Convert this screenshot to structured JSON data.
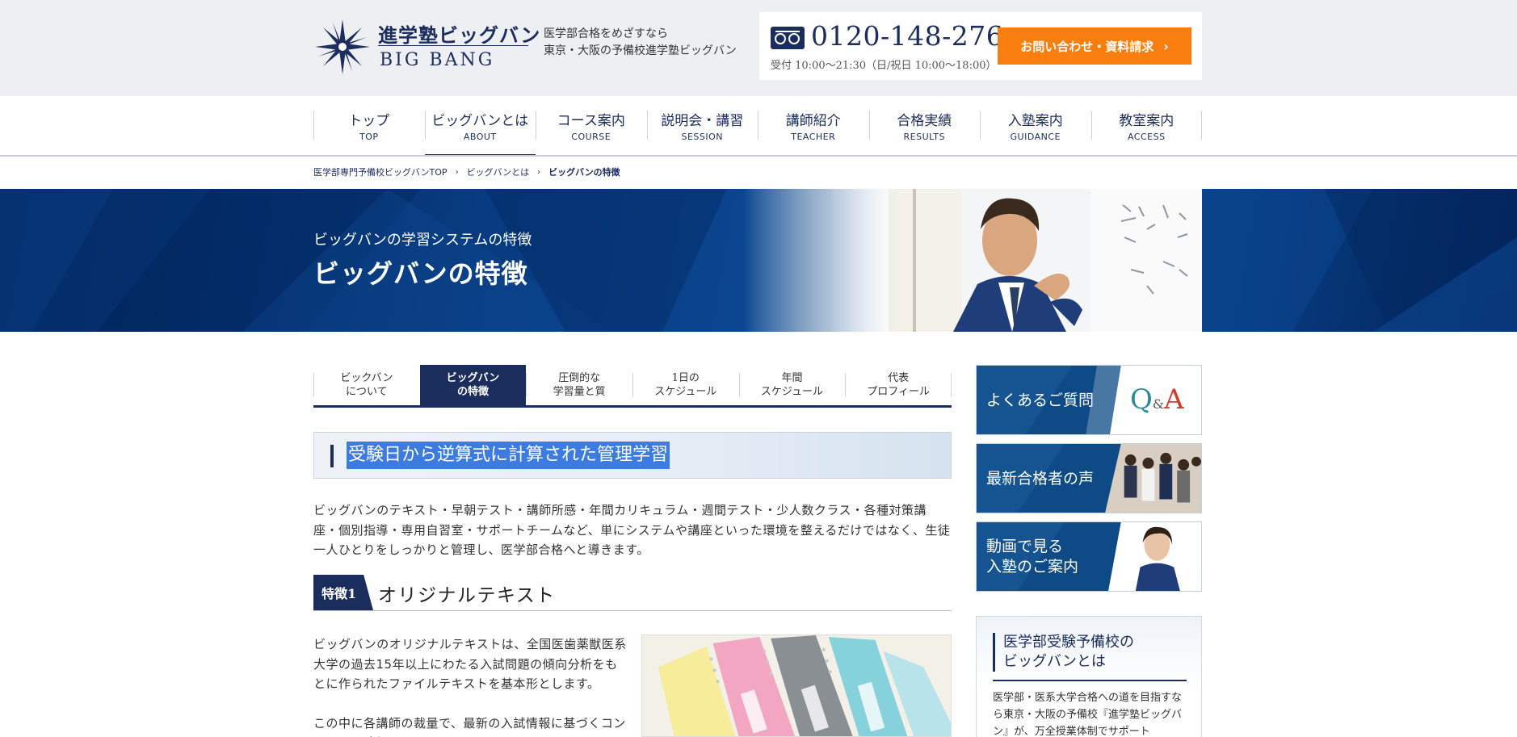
{
  "header": {
    "logo_jp": "進学塾ビッグバン",
    "logo_en": "BIG BANG",
    "tagline_line1": "医学部合格をめざすなら",
    "tagline_line2": "東京・大阪の予備校進学塾ビッグバン",
    "phone": "0120-148-276",
    "hours": "受付 10:00〜21:30（日/祝日 10:00〜18:00）",
    "cta_label": "お問い合わせ・資料請求",
    "cta_chevron": "›"
  },
  "nav": [
    {
      "jp": "トップ",
      "en": "TOP"
    },
    {
      "jp": "ビッグバンとは",
      "en": "ABOUT"
    },
    {
      "jp": "コース案内",
      "en": "COURSE"
    },
    {
      "jp": "説明会・講習",
      "en": "SESSION"
    },
    {
      "jp": "講師紹介",
      "en": "TEACHER"
    },
    {
      "jp": "合格実績",
      "en": "RESULTS"
    },
    {
      "jp": "入塾案内",
      "en": "GUIDANCE"
    },
    {
      "jp": "教室案内",
      "en": "ACCESS"
    }
  ],
  "nav_active_index": 1,
  "breadcrumb": {
    "home": "医学部専門予備校ビッグバンTOP",
    "parent": "ビッグバンとは",
    "current": "ビッグバンの特徴",
    "sep": "›"
  },
  "hero": {
    "subtitle": "ビッグバンの学習システムの特徴",
    "title": "ビッグバンの特徴"
  },
  "subtabs": [
    {
      "line1": "ビックバン",
      "line2": "について"
    },
    {
      "line1": "ビッグバン",
      "line2": "の特徴"
    },
    {
      "line1": "圧倒的な",
      "line2": "学習量と質"
    },
    {
      "line1": "1日の",
      "line2": "スケジュール"
    },
    {
      "line1": "年間",
      "line2": "スケジュール"
    },
    {
      "line1": "代表",
      "line2": "プロフィール"
    }
  ],
  "subtab_active_index": 1,
  "main": {
    "section_heading": "受験日から逆算式に計算された管理学習",
    "intro": "ビッグバンのテキスト・早朝テスト・講師所感・年間カリキュラム・週間テスト・少人数クラス・各種対策講座・個別指導・専用自習室・サポートチームなど、単にシステムや講座といった環境を整えるだけではなく、生徒一人ひとりをしっかりと管理し、医学部合格へと導きます。",
    "feature_badge": "特徴1",
    "feature_title": "オリジナルテキスト",
    "feature_p1": "ビッグバンのオリジナルテキストは、全国医歯薬獣医系大学の過去15年以上にわたる入試問題の傾向分析をもとに作られたファイルテキストを基本形とします。",
    "feature_p2": "この中に各講師の裁量で、最新の入試情報に基づくコンテンツを追加していきます。"
  },
  "sidebar": {
    "faq_label": "よくあるご質問",
    "qa_q": "Q",
    "qa_amp": "&",
    "qa_a": "A",
    "voice_label": "最新合格者の声",
    "video_line1": "動画で見る",
    "video_line2": "入塾のご案内",
    "about_title_line1": "医学部受験予備校の",
    "about_title_line2": "ビッグバンとは",
    "about_text": "医学部・医系大学合格への道を目指すなら東京・大阪の予備校『進学塾ビッグバン』が、万全授業体制でサポート"
  },
  "colors": {
    "navy": "#1b2d5c",
    "orange": "#f97e10",
    "header_bg": "#eeeff2",
    "qa_teal": "#2a8a9a",
    "qa_red": "#d33a2e",
    "highlight": "#3c7be0"
  }
}
